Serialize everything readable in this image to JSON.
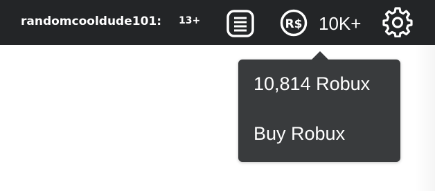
{
  "header": {
    "username": "randomcooldude101:",
    "age_label": "13+",
    "robux_short": "10K+",
    "catalog_icon": "catalog-list-icon",
    "robux_icon": "robux-icon",
    "settings_icon": "gear-icon"
  },
  "robux_menu": {
    "balance_label": "10,814 Robux",
    "buy_label": "Buy Robux"
  },
  "colors": {
    "topbar": "#232527",
    "popover": "#393b3d",
    "text": "#ffffff"
  }
}
